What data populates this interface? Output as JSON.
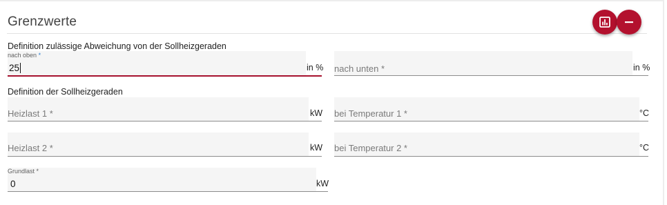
{
  "section": {
    "title": "Grenzwerte"
  },
  "actions": {
    "chart_icon": "bar-chart-icon",
    "remove_icon": "minus-icon",
    "color": "#b3112e"
  },
  "deviation": {
    "heading": "Definition zulässige Abweichung von der Sollheizgeraden",
    "upper": {
      "label": "nach oben",
      "required_mark": "*",
      "value": "25",
      "unit": "in %"
    },
    "lower": {
      "placeholder": "nach unten *",
      "value": "",
      "unit": "in %"
    }
  },
  "curve": {
    "heading": "Definition der Sollheizgeraden",
    "heizlast1": {
      "placeholder": "Heizlast 1 *",
      "unit": "kW"
    },
    "temp1": {
      "placeholder": "bei Temperatur 1 *",
      "unit": "°C"
    },
    "heizlast2": {
      "placeholder": "Heizlast 2 *",
      "unit": "kW"
    },
    "temp2": {
      "placeholder": "bei Temperatur 2 *",
      "unit": "°C"
    },
    "grundlast": {
      "label": "Grundlast *",
      "value": "0",
      "unit": "kW"
    }
  }
}
